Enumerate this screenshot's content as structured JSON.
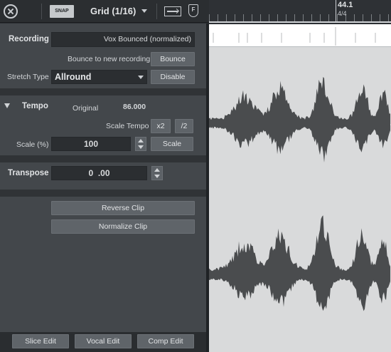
{
  "toolbar": {
    "snap_label": "SNAP",
    "grid_label": "Grid (1/16)",
    "f_label": "F"
  },
  "ruler": {
    "bar": "44.1",
    "time_signature": "4/4"
  },
  "recording": {
    "label": "Recording",
    "name_value": "Vox Bounced (normalized)",
    "bounce_text": "Bounce to new recording",
    "bounce_button": "Bounce",
    "stretch_label": "Stretch Type",
    "stretch_value": "Allround",
    "disable_button": "Disable"
  },
  "tempo": {
    "label": "Tempo",
    "original_label": "Original",
    "original_value": "86.000",
    "scale_tempo_label": "Scale Tempo",
    "x2_button": "x2",
    "half_button": "/2",
    "scale_label": "Scale (%)",
    "scale_value": "100",
    "scale_button": "Scale"
  },
  "transpose": {
    "label": "Transpose",
    "value": "0  .00"
  },
  "actions": {
    "reverse_button": "Reverse Clip",
    "normalize_button": "Normalize Clip"
  },
  "bottom": {
    "slice_edit": "Slice Edit",
    "vocal_edit": "Vocal Edit",
    "comp_edit": "Comp Edit"
  },
  "colors": {
    "waveform": "#4a4c4e",
    "waveform_bg": "#d9dadb",
    "panel": "#43474b",
    "button": "#5f6469"
  }
}
